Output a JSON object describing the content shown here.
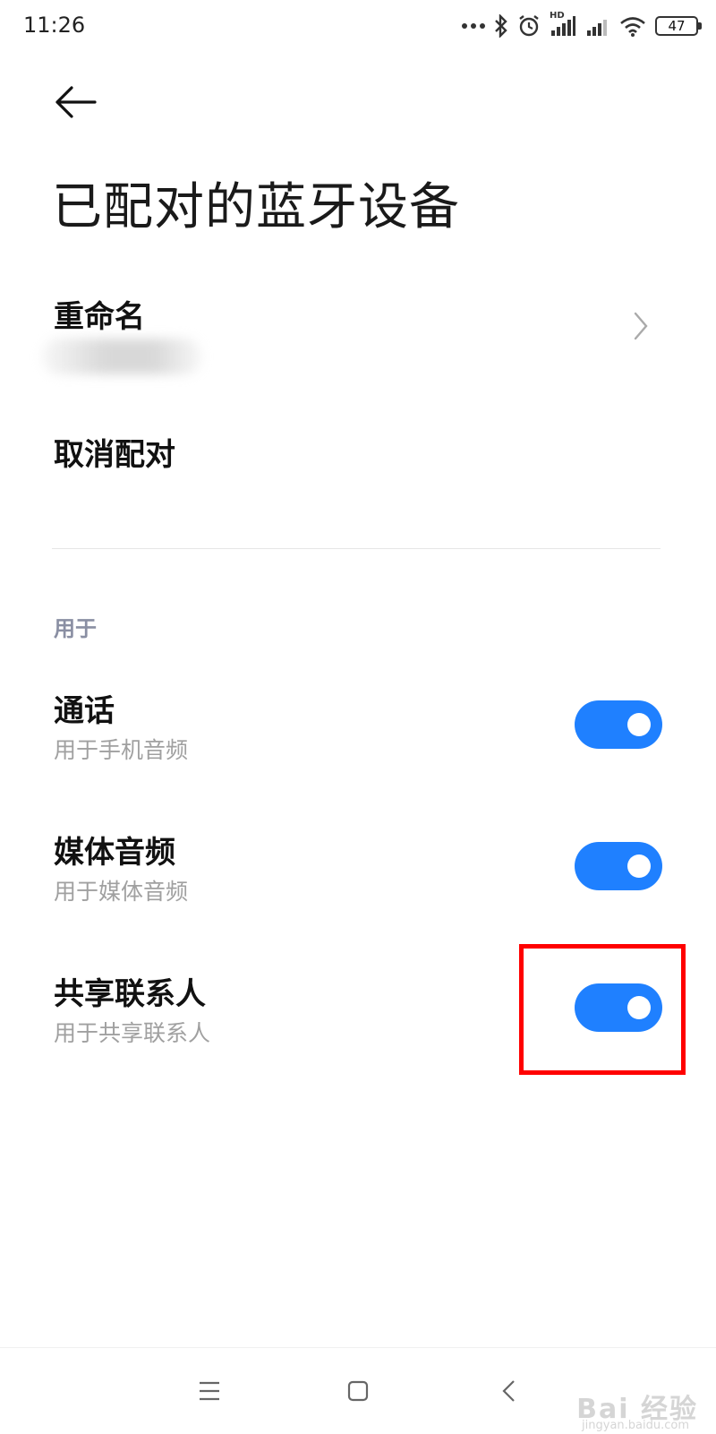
{
  "status_bar": {
    "time": "11:26",
    "network_label": "HD",
    "battery": "47",
    "icons": [
      "more-dots-icon",
      "bluetooth-icon",
      "alarm-icon",
      "signal-icon",
      "signal-icon",
      "wifi-icon",
      "battery-icon"
    ]
  },
  "header": {
    "back_icon": "back-arrow-icon",
    "title": "已配对的蓝牙设备"
  },
  "actions": {
    "rename": "重命名",
    "unpair": "取消配对"
  },
  "section": {
    "label": "用于"
  },
  "toggles": [
    {
      "title": "通话",
      "subtitle": "用于手机音频",
      "enabled": true
    },
    {
      "title": "媒体音频",
      "subtitle": "用于媒体音频",
      "enabled": true
    },
    {
      "title": "共享联系人",
      "subtitle": "用于共享联系人",
      "enabled": true
    }
  ],
  "colors": {
    "accent": "#1f80ff",
    "highlight": "#ff0000",
    "section_label": "#8a8fa3",
    "subtitle": "#a0a0a0"
  },
  "nav_bar": {
    "icons": [
      "menu-icon",
      "home-icon",
      "back-icon"
    ]
  },
  "watermark": {
    "main": "Bai 经验",
    "sub": "jingyan.baidu.com"
  }
}
